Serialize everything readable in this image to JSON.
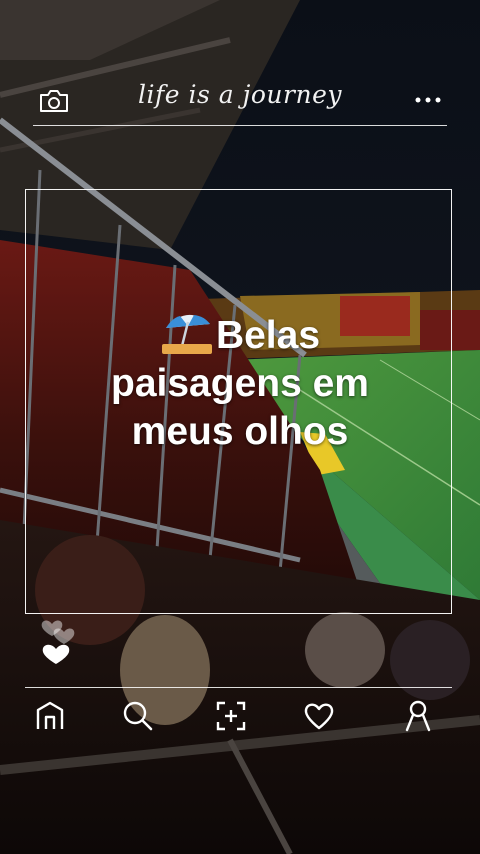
{
  "header": {
    "brand_text": "life is a journey",
    "camera_icon": "camera-icon",
    "menu_icon": "more-dots-icon"
  },
  "post": {
    "caption_emoji": "beach-umbrella-emoji",
    "caption_line1": "Belas",
    "caption_line2": "paisagens em",
    "caption_line3": "meus olhos"
  },
  "reactions": {
    "icons": [
      "heart-outline-icon",
      "heart-outline-icon",
      "heart-filled-icon"
    ]
  },
  "bottom_nav": {
    "items": [
      "home-icon",
      "search-icon",
      "add-post-icon",
      "heart-icon",
      "profile-icon"
    ]
  },
  "colors": {
    "pitch_green": "#3f8a3a",
    "stand_red": "#8a1f1a",
    "night_sky": "#0a0e16",
    "ui_white": "#ffffff"
  }
}
